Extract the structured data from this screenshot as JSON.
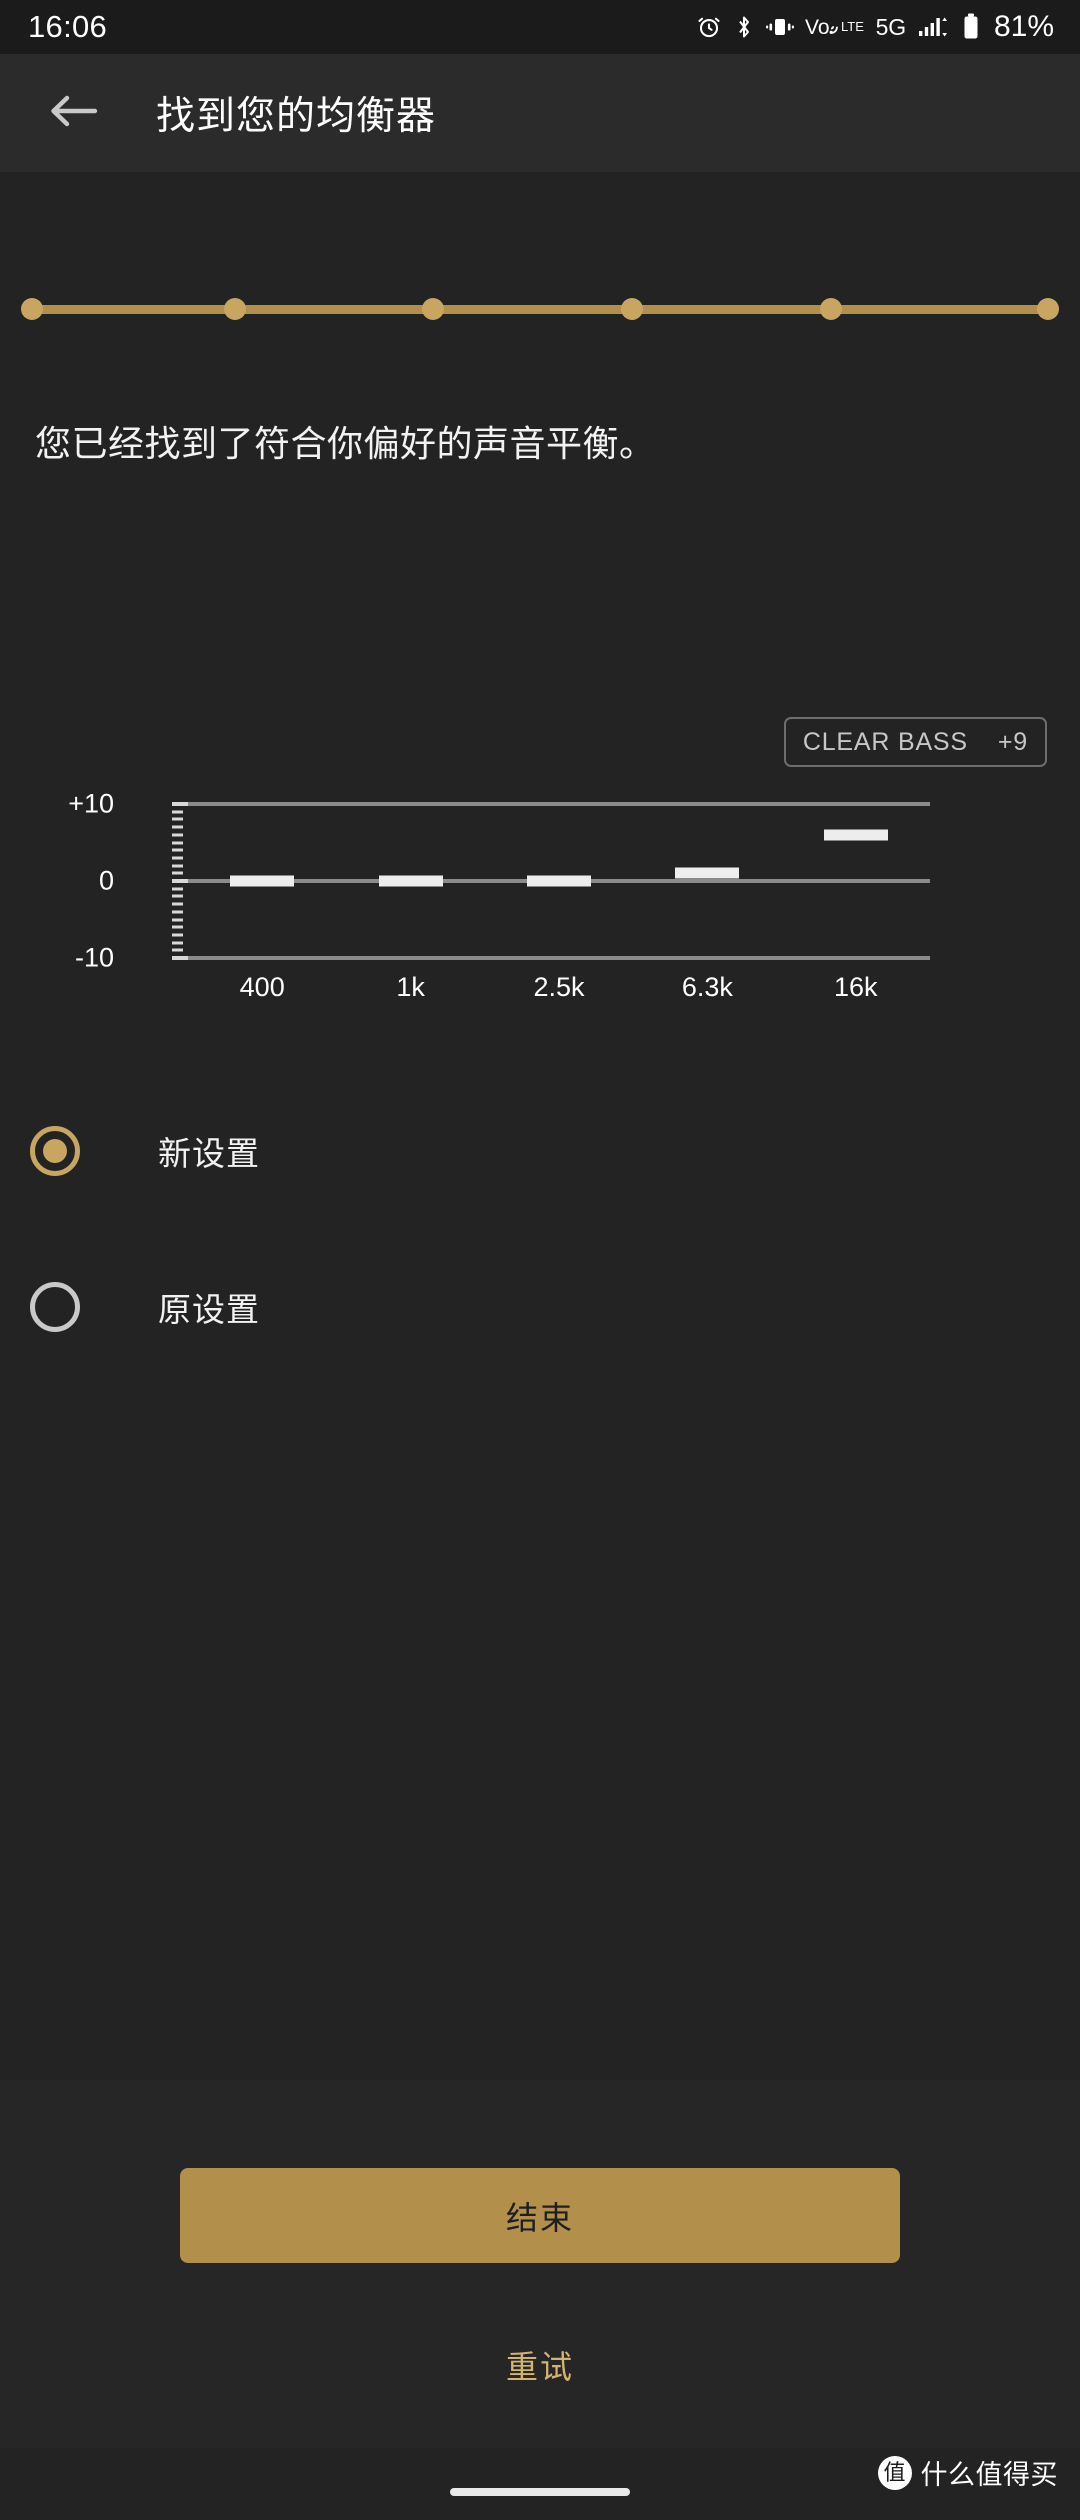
{
  "statusbar": {
    "time": "16:06",
    "network_label": "5G",
    "battery_label": "81%",
    "icons": [
      "alarm-icon",
      "bluetooth-icon",
      "vibrate-icon",
      "volte-icon",
      "signal-icon",
      "battery-icon"
    ]
  },
  "toolbar": {
    "back_icon": "arrow-left-icon",
    "title": "找到您的均衡器"
  },
  "progress": {
    "total_steps": 6,
    "current_step": 6,
    "active_color": "#c8a662",
    "rail_color": "#b28f4b"
  },
  "main": {
    "headline": "您已经找到了符合你偏好的声音平衡。",
    "clear_bass": {
      "label": "CLEAR BASS",
      "value": "+9"
    }
  },
  "chart_data": {
    "type": "bar",
    "title": "",
    "xlabel": "",
    "ylabel": "",
    "categories": [
      "400",
      "1k",
      "2.5k",
      "6.3k",
      "16k"
    ],
    "values": [
      0,
      0,
      0,
      1,
      6
    ],
    "ylim": [
      -10,
      10
    ],
    "ytick_labels": [
      "+10",
      "0",
      "-10"
    ],
    "ytick_values": [
      10,
      0,
      -10
    ],
    "minor_tick_step": 1,
    "grid": true,
    "legend": "none",
    "bar_color": "#ededed",
    "axis_color": "#8b8b8b"
  },
  "options": {
    "items": [
      {
        "label": "新设置",
        "selected": true
      },
      {
        "label": "原设置",
        "selected": false
      }
    ]
  },
  "footer": {
    "primary_button": "结束",
    "text_button": "重试"
  },
  "watermark": {
    "logo_text": "值",
    "text": "什么值得买"
  }
}
